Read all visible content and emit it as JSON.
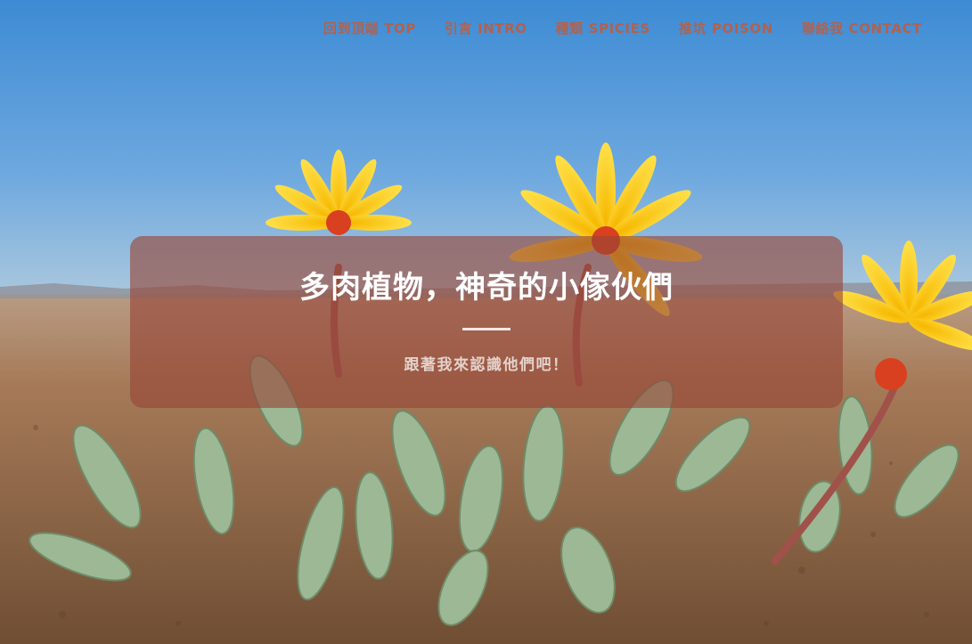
{
  "nav": {
    "items": [
      {
        "label": "回到頂端 TOP"
      },
      {
        "label": "引言 INTRO"
      },
      {
        "label": "種類 SPICIES"
      },
      {
        "label": "推坑 POISON"
      },
      {
        "label": "聯絡我 CONTACT"
      }
    ],
    "color": "#b0624f"
  },
  "hero": {
    "title": "多肉植物，神奇的小傢伙們",
    "subtitle": "跟著我來認識他們吧！",
    "image": "succulent-flowers-photo"
  }
}
